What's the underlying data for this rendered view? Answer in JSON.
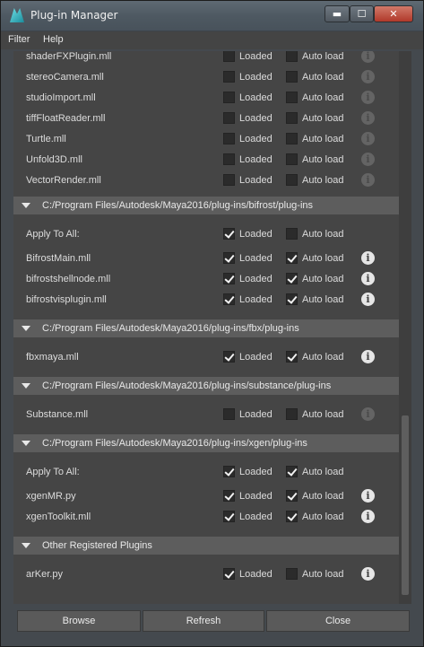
{
  "window": {
    "title": "Plug-in Manager",
    "buttons": {
      "minimize": "▬",
      "maximize": "☐",
      "close": "✕"
    }
  },
  "menu": [
    "Filter",
    "Help"
  ],
  "labels": {
    "loaded": "Loaded",
    "auto_load": "Auto load",
    "info": "i"
  },
  "top_rows": [
    {
      "name": "shaderFXPlugin.mll",
      "loaded": false,
      "auto": false,
      "info_active": false
    },
    {
      "name": "stereoCamera.mll",
      "loaded": false,
      "auto": false,
      "info_active": false
    },
    {
      "name": "studioImport.mll",
      "loaded": false,
      "auto": false,
      "info_active": false
    },
    {
      "name": "tiffFloatReader.mll",
      "loaded": false,
      "auto": false,
      "info_active": false
    },
    {
      "name": "Turtle.mll",
      "loaded": false,
      "auto": false,
      "info_active": false
    },
    {
      "name": "Unfold3D.mll",
      "loaded": false,
      "auto": false,
      "info_active": false
    },
    {
      "name": "VectorRender.mll",
      "loaded": false,
      "auto": false,
      "info_active": false
    }
  ],
  "sections": [
    {
      "path": "C:/Program Files/Autodesk/Maya2016/plug-ins/bifrost/plug-ins",
      "rows": [
        {
          "name": "Apply To All:",
          "loaded": true,
          "auto": false,
          "info": false
        },
        {
          "name": "BifrostMain.mll",
          "loaded": true,
          "auto": true,
          "info": true
        },
        {
          "name": "bifrostshellnode.mll",
          "loaded": true,
          "auto": true,
          "info": true
        },
        {
          "name": "bifrostvisplugin.mll",
          "loaded": true,
          "auto": true,
          "info": true
        }
      ]
    },
    {
      "path": "C:/Program Files/Autodesk/Maya2016/plug-ins/fbx/plug-ins",
      "rows": [
        {
          "name": "fbxmaya.mll",
          "loaded": true,
          "auto": true,
          "info": true
        }
      ]
    },
    {
      "path": "C:/Program Files/Autodesk/Maya2016/plug-ins/substance/plug-ins",
      "rows": [
        {
          "name": "Substance.mll",
          "loaded": false,
          "auto": false,
          "info": "dim"
        }
      ]
    },
    {
      "path": "C:/Program Files/Autodesk/Maya2016/plug-ins/xgen/plug-ins",
      "rows": [
        {
          "name": "Apply To All:",
          "loaded": true,
          "auto": true,
          "info": false
        },
        {
          "name": "xgenMR.py",
          "loaded": true,
          "auto": true,
          "info": true
        },
        {
          "name": "xgenToolkit.mll",
          "loaded": true,
          "auto": true,
          "info": true
        }
      ]
    },
    {
      "path": "Other Registered Plugins",
      "rows": [
        {
          "name": "arKer.py",
          "loaded": true,
          "auto": false,
          "info": true
        }
      ]
    }
  ],
  "footer": {
    "browse": "Browse",
    "refresh": "Refresh",
    "close": "Close"
  }
}
